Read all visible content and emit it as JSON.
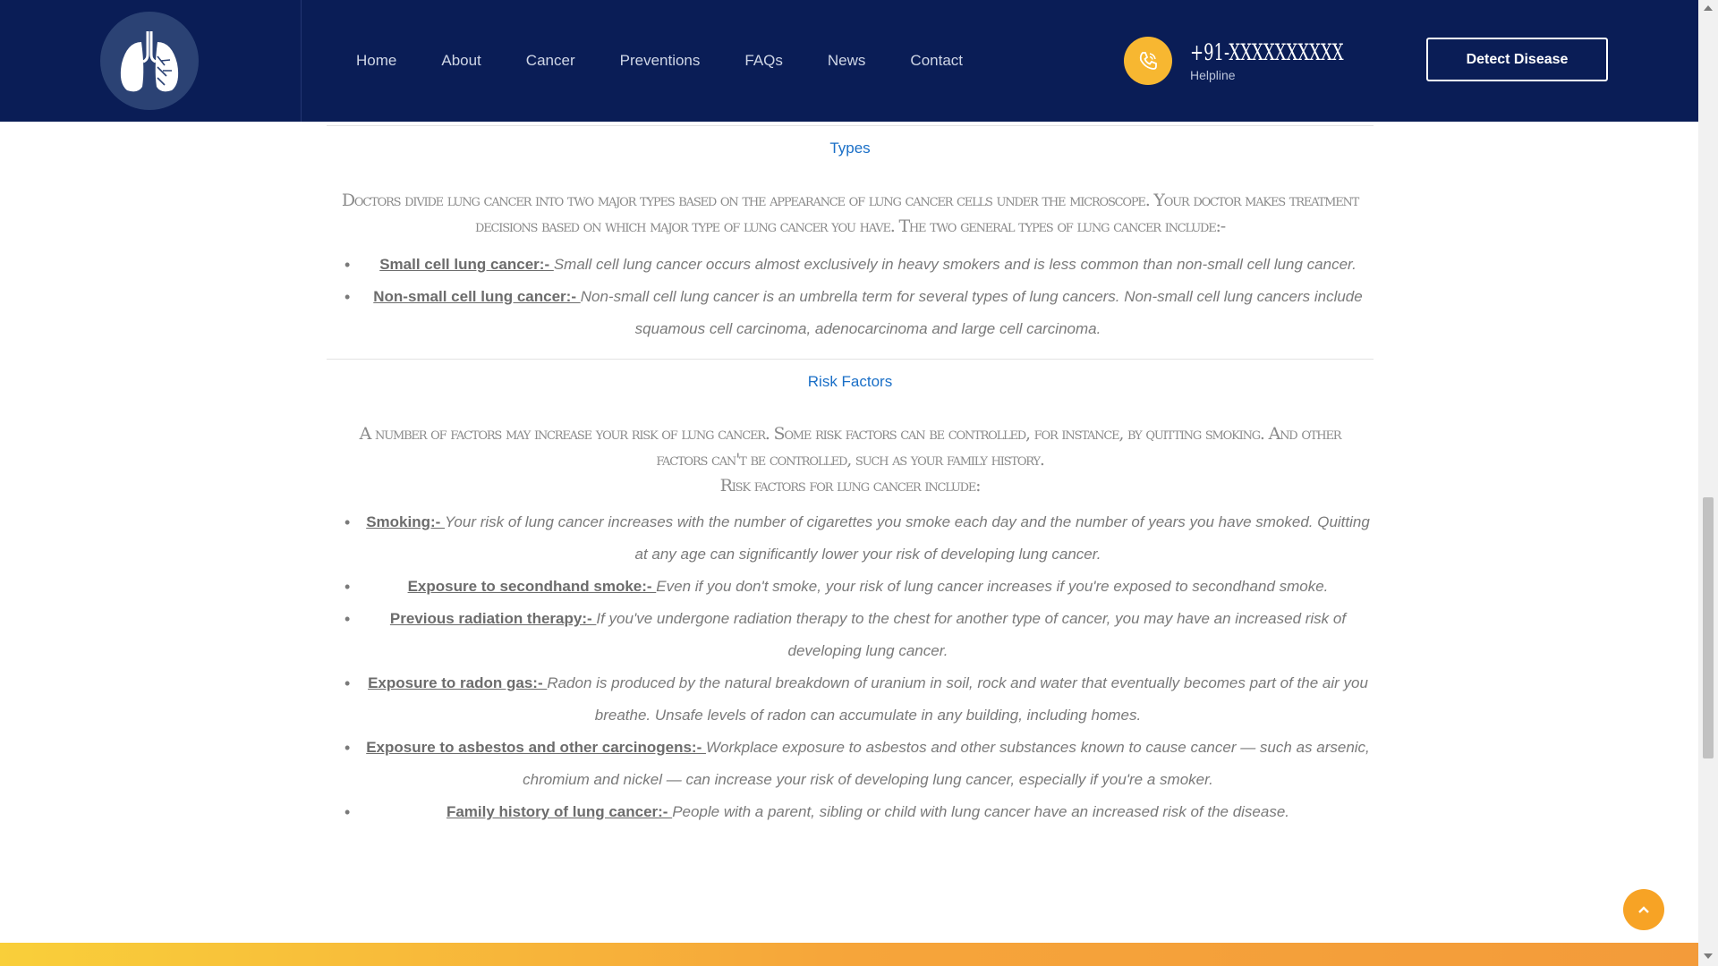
{
  "colors": {
    "header_bg": "#0a1d56",
    "accent": "#f7b731",
    "link_blue": "#1a6fc7",
    "text_gray": "#7a7a7a"
  },
  "header": {
    "logo_icon": "lungs-icon",
    "nav": [
      "Home",
      "About",
      "Cancer",
      "Preventions",
      "FAQs",
      "News",
      "Contact"
    ],
    "phone_icon": "phone-icon",
    "phone_number": "+91-XXXXXXXXXX",
    "helpline_label": "Helpline",
    "detect_button": "Detect Disease"
  },
  "types": {
    "title": "Types",
    "lead": "Doctors divide lung cancer into two major types based on the appearance of lung cancer cells under the microscope. Your doctor makes treatment decisions based on which major type of lung cancer you have. The two general types of lung cancer include:-",
    "items": [
      {
        "term": "Small cell lung cancer:- ",
        "desc": "Small cell lung cancer occurs almost exclusively in heavy smokers and is less common than non-small cell lung cancer."
      },
      {
        "term": "Non-small cell lung cancer:- ",
        "desc": "Non-small cell lung cancer is an umbrella term for several types of lung cancers. Non-small cell lung cancers include squamous cell carcinoma, adenocarcinoma and large cell carcinoma."
      }
    ]
  },
  "risk": {
    "title": "Risk Factors",
    "lead": "A number of factors may increase your risk of lung cancer. Some risk factors can be controlled, for instance, by quitting smoking. And other factors can't be controlled, such as your family history.",
    "lead2": "Risk factors for lung cancer include:",
    "items": [
      {
        "term": "Smoking:- ",
        "desc": "Your risk of lung cancer increases with the number of cigarettes you smoke each day and the number of years you have smoked. Quitting at any age can significantly lower your risk of developing lung cancer."
      },
      {
        "term": "Exposure to secondhand smoke:- ",
        "desc": "Even if you don't smoke, your risk of lung cancer increases if you're exposed to secondhand smoke."
      },
      {
        "term": "Previous radiation therapy:- ",
        "desc": "If you've undergone radiation therapy to the chest for another type of cancer, you may have an increased risk of developing lung cancer."
      },
      {
        "term": "Exposure to radon gas:- ",
        "desc": "Radon is produced by the natural breakdown of uranium in soil, rock and water that eventually becomes part of the air you breathe. Unsafe levels of radon can accumulate in any building, including homes."
      },
      {
        "term": "Exposure to asbestos and other carcinogens:- ",
        "desc": "Workplace exposure to asbestos and other substances known to cause cancer — such as arsenic, chromium and nickel — can increase your risk of developing lung cancer, especially if you're a smoker."
      },
      {
        "term": "Family history of lung cancer:- ",
        "desc": "People with a parent, sibling or child with lung cancer have an increased risk of the disease."
      }
    ]
  },
  "scroll_top_icon": "chevron-up-icon"
}
